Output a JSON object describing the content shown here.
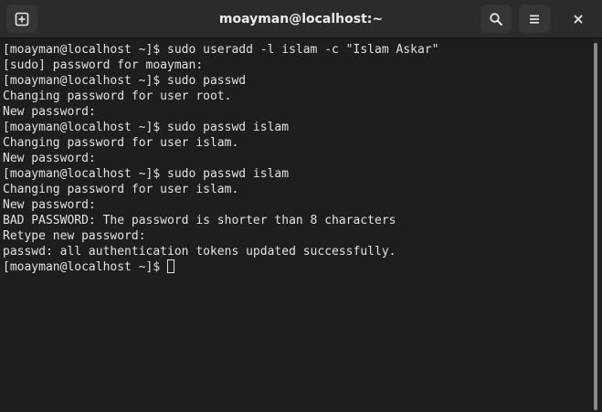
{
  "window": {
    "title": "moayman@localhost:~"
  },
  "toolbar": {
    "new_tab_icon": "new-tab-icon",
    "search_icon": "search-icon",
    "menu_icon": "hamburger-menu-icon",
    "close_icon": "close-icon"
  },
  "terminal": {
    "lines": [
      "[moayman@localhost ~]$ sudo useradd -l islam -c \"Islam Askar\"",
      "[sudo] password for moayman:",
      "[moayman@localhost ~]$ sudo passwd",
      "Changing password for user root.",
      "New password:",
      "[moayman@localhost ~]$ sudo passwd islam",
      "Changing password for user islam.",
      "New password:",
      "[moayman@localhost ~]$ sudo passwd islam",
      "Changing password for user islam.",
      "New password:",
      "BAD PASSWORD: The password is shorter than 8 characters",
      "Retype new password:",
      "passwd: all authentication tokens updated successfully."
    ],
    "prompt": "[moayman@localhost ~]$"
  },
  "colors": {
    "background": "#1e1e1e",
    "headerbar": "#2b2b2b",
    "text": "#e2e2e2"
  }
}
